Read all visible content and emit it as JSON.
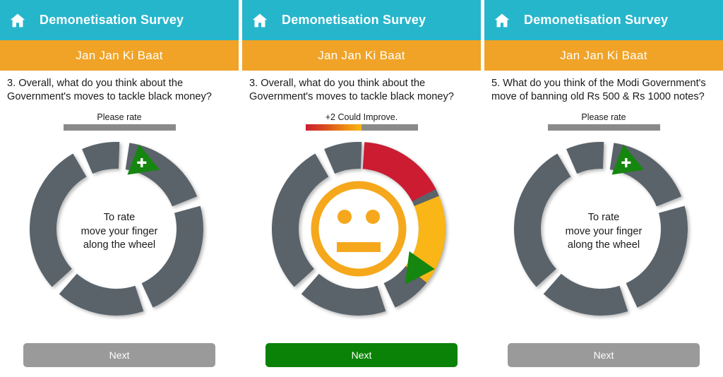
{
  "colors": {
    "header_teal": "#26b6cc",
    "sub_orange": "#f0a326",
    "wheel_gray": "#5a636b",
    "segment_red": "#cc1f33",
    "segment_amber": "#fab513",
    "marker_green": "#15860f",
    "btn_disabled_gray": "#9a9a9a",
    "btn_active_green": "#0a8207",
    "face_orange": "#f5a81c"
  },
  "header": {
    "home_icon": "home-icon",
    "title": "Demonetisation Survey",
    "subtitle": "Jan Jan Ki Baat"
  },
  "panels": [
    {
      "question": "3. Overall, what do you think about the Government's moves to tackle black money?",
      "rate_label": "Please rate",
      "rate_fill_percent": 0,
      "wheel_state": "unrated",
      "wheel_center_lines": [
        "To rate",
        "move your finger",
        "along the wheel"
      ],
      "marker_icon": "plus-marker-icon",
      "marker_angle_deg": 22,
      "next_label": "Next",
      "next_enabled": false
    },
    {
      "question": "3. Overall, what do you think about the Government's moves to tackle black money?",
      "rate_label": "+2 Could Improve.",
      "rate_fill_percent": 50,
      "wheel_state": "rated",
      "wheel_center_lines": [],
      "face_icon": "neutral-face-icon",
      "marker_icon": "green-triangle-marker-icon",
      "marker_angle_deg": 125,
      "segments": [
        {
          "name": "red-segment",
          "color": "#cc1f33",
          "start_deg": 4,
          "end_deg": 63
        },
        {
          "name": "amber-segment",
          "color": "#fab513",
          "start_deg": 67,
          "end_deg": 128
        }
      ],
      "next_label": "Next",
      "next_enabled": true
    },
    {
      "question": "5. What do you think of the Modi Government's move of banning old Rs 500 & Rs 1000 notes?",
      "rate_label": "Please rate",
      "rate_fill_percent": 0,
      "wheel_state": "unrated",
      "wheel_center_lines": [
        "To rate",
        "move your finger",
        "along the wheel"
      ],
      "marker_icon": "plus-marker-icon",
      "marker_angle_deg": 22,
      "next_label": "Next",
      "next_enabled": false
    }
  ]
}
